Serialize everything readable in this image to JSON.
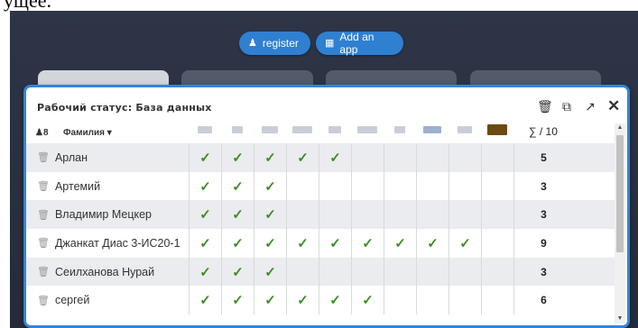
{
  "top_text": "ущее.",
  "buttons": {
    "register": "register",
    "add_app": "Add an app"
  },
  "panel": {
    "title": "Рабочий статус: База данных",
    "tools": [
      "trash-icon",
      "copy-icon",
      "external-link-icon",
      "close-icon"
    ],
    "header": {
      "count": "8",
      "sort_label": "Фамилия ▾",
      "sum_label": "∑ / 10"
    },
    "rows": [
      {
        "name": "Арлан",
        "checks": [
          1,
          1,
          1,
          1,
          1,
          0,
          0,
          0,
          0,
          0
        ],
        "sum": "5"
      },
      {
        "name": "Артемий",
        "checks": [
          1,
          1,
          1,
          0,
          0,
          0,
          0,
          0,
          0,
          0
        ],
        "sum": "3"
      },
      {
        "name": "Владимир Мецкер",
        "checks": [
          1,
          1,
          1,
          0,
          0,
          0,
          0,
          0,
          0,
          0
        ],
        "sum": "3"
      },
      {
        "name": "Джанкат Диас 3-ИС20-1",
        "checks": [
          1,
          1,
          1,
          1,
          1,
          1,
          1,
          1,
          1,
          0
        ],
        "sum": "9"
      },
      {
        "name": "Сеилханова Нурай",
        "checks": [
          1,
          1,
          1,
          0,
          0,
          0,
          0,
          0,
          0,
          0
        ],
        "sum": "3"
      },
      {
        "name": "сергей",
        "checks": [
          1,
          1,
          1,
          1,
          1,
          1,
          0,
          0,
          0,
          0
        ],
        "sum": "6"
      }
    ],
    "check_mark": "✓"
  },
  "colors": {
    "accent": "#2f86da",
    "check": "#3e8d28"
  }
}
